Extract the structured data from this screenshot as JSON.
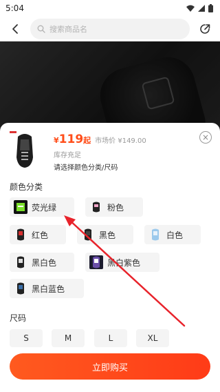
{
  "status_bar": {
    "time": "5:04"
  },
  "header": {
    "search_placeholder": "搜索商品名"
  },
  "product": {
    "currency": "¥",
    "price": "119",
    "price_suffix": "起",
    "market_price_label": "市场价",
    "market_price": "¥149.00",
    "stock": "库存充足",
    "select_hint": "请选择颜色分类/尺码"
  },
  "color_section": {
    "title": "颜色分类",
    "options": [
      {
        "label": "荧光绿",
        "swatch": "#7adf2a"
      },
      {
        "label": "粉色",
        "swatch": "#f3a6c8"
      },
      {
        "label": "红色",
        "swatch": "#d83030"
      },
      {
        "label": "黑色",
        "swatch": "#222222"
      },
      {
        "label": "白色",
        "swatch": "#e8f2fb"
      },
      {
        "label": "黑白色",
        "swatch": "#555555"
      },
      {
        "label": "黑白紫色",
        "swatch": "#6a4ea8"
      },
      {
        "label": "黑白蓝色",
        "swatch": "#3a6ea8"
      }
    ]
  },
  "size_section": {
    "title": "尺码",
    "options": [
      "S",
      "M",
      "L",
      "XL"
    ]
  },
  "buy_button": {
    "label": "立即购买"
  },
  "colors": {
    "accent": "#ff4e1a",
    "arrow": "#e8232b"
  },
  "icons": {
    "back": "chevron-left-icon",
    "search": "search-icon",
    "share": "share-icon",
    "close": "close-icon",
    "wifi": "wifi-icon",
    "signal": "signal-icon",
    "battery": "battery-icon"
  }
}
